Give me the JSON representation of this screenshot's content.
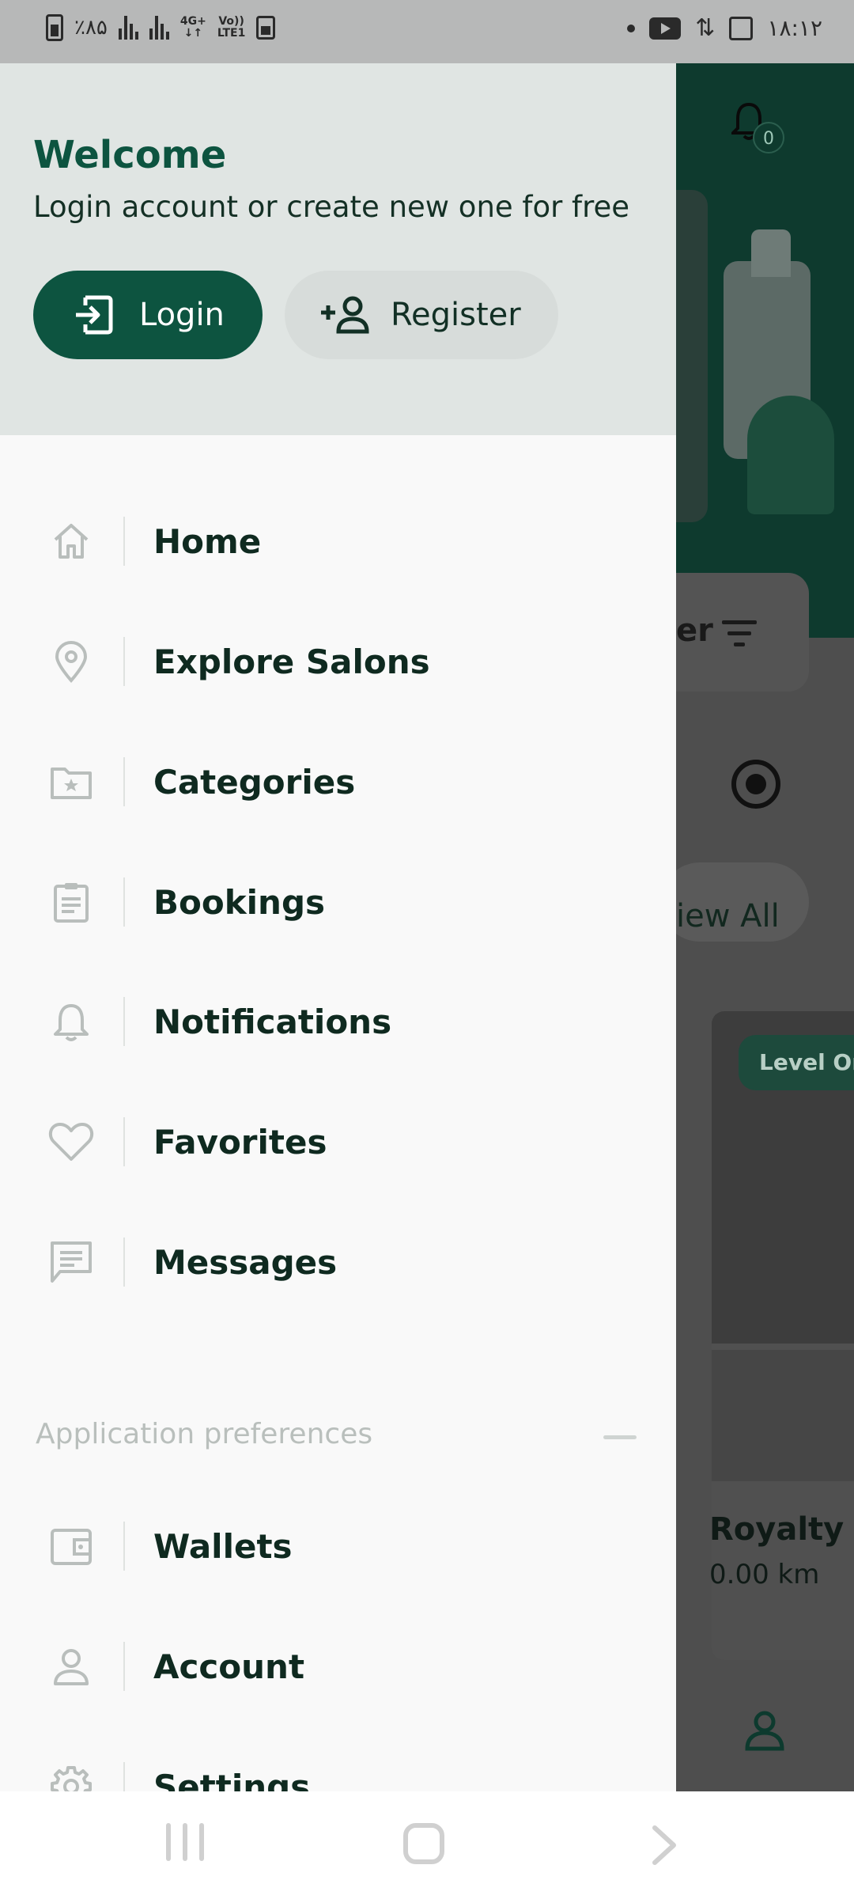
{
  "status_bar": {
    "battery": "٪۸۵",
    "network_top": "4G+",
    "network_bottom": "↓↑",
    "volte_top": "Vo))",
    "volte_bottom": "LTE1",
    "time": "۱۸:۱۲"
  },
  "drawer": {
    "welcome_title": "Welcome",
    "welcome_subtitle": "Login account or create new one for free",
    "login_label": "Login",
    "register_label": "Register",
    "menu_items": [
      {
        "label": "Home",
        "icon": "home-icon"
      },
      {
        "label": "Explore Salons",
        "icon": "location-pin-icon"
      },
      {
        "label": "Categories",
        "icon": "folder-star-icon"
      },
      {
        "label": "Bookings",
        "icon": "clipboard-icon"
      },
      {
        "label": "Notifications",
        "icon": "bell-icon"
      },
      {
        "label": "Favorites",
        "icon": "heart-icon"
      },
      {
        "label": "Messages",
        "icon": "message-icon"
      }
    ],
    "preferences_label": "Application preferences",
    "preference_items": [
      {
        "label": "Wallets",
        "icon": "wallet-icon"
      },
      {
        "label": "Account",
        "icon": "person-icon"
      },
      {
        "label": "Settings",
        "icon": "gear-icon"
      }
    ]
  },
  "background_app": {
    "notification_count": "0",
    "filter_text_fragment": "er",
    "view_all_fragment": "iew All",
    "card_badge_fragment": "Level Or",
    "card_title_fragment": "Royalty",
    "card_distance_fragment": "0.00 km"
  },
  "colors": {
    "primary": "#0d5440",
    "header_bg": "#e0e5e3",
    "drawer_bg": "#f9f9f9",
    "menu_text": "#0f2a20",
    "icon_gray": "#b9bebc"
  }
}
